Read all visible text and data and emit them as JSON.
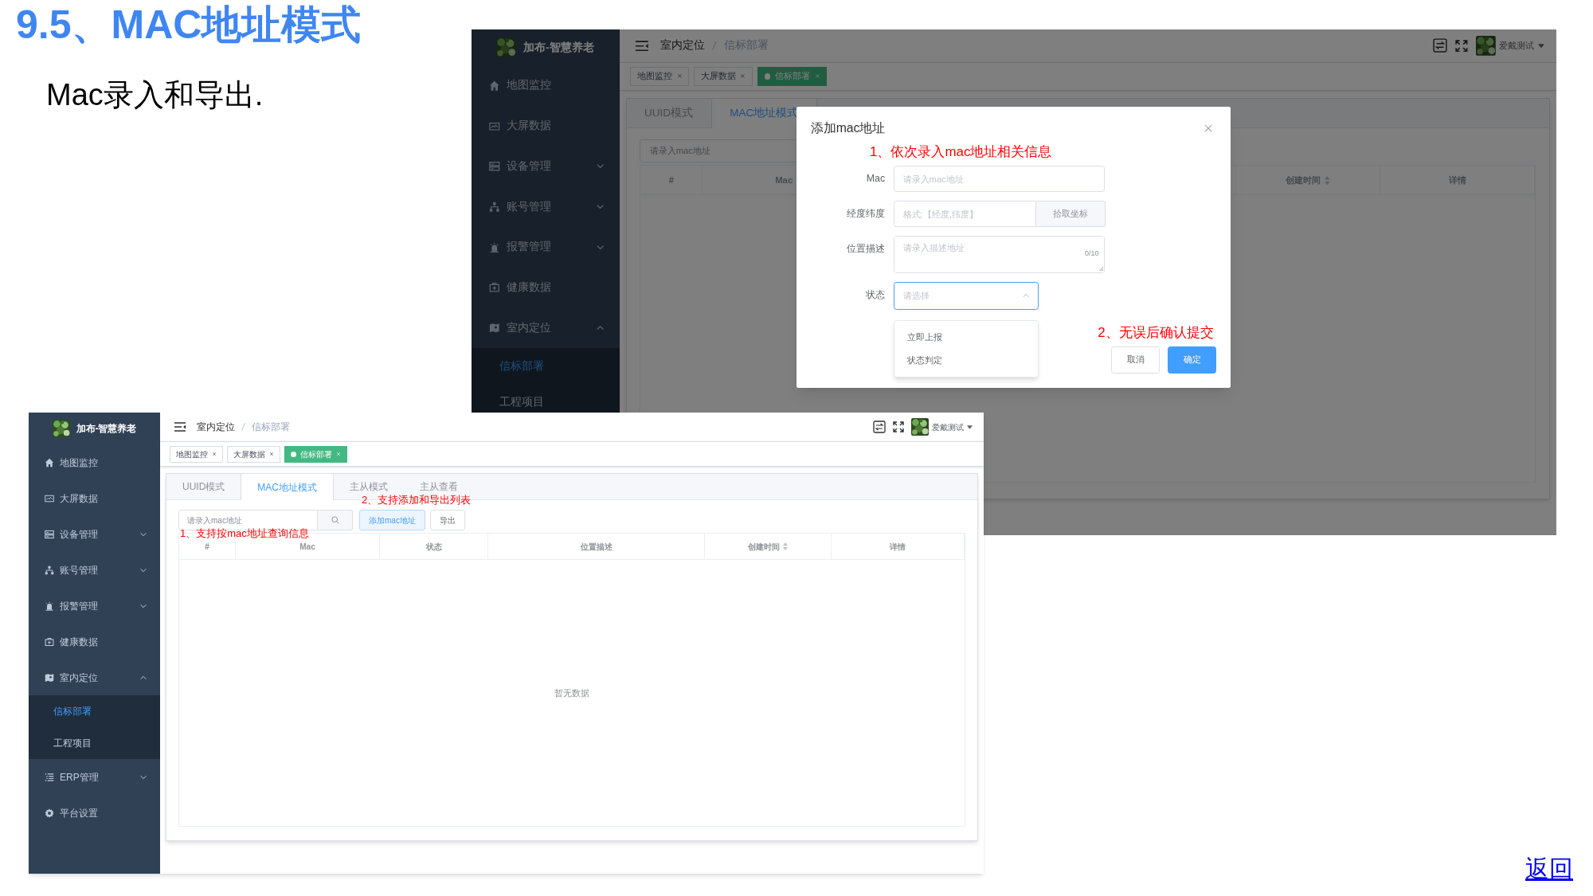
{
  "slide": {
    "title": "9.5、MAC地址模式",
    "subtitle": "Mac录入和导出.",
    "back_link": "返回"
  },
  "screenshots": [
    {
      "app": {
        "sidebar": {
          "logo_text": "加布-智慧养老",
          "items": [
            {
              "label": "地图监控"
            },
            {
              "label": "大屏数据"
            },
            {
              "label": "设备管理",
              "expanded": false
            },
            {
              "label": "账号管理",
              "expanded": false
            },
            {
              "label": "报警管理",
              "expanded": false
            },
            {
              "label": "健康数据"
            },
            {
              "label": "室内定位",
              "expanded": true,
              "children": [
                {
                  "label": "信标部署",
                  "selected": true
                },
                {
                  "label": "工程项目",
                  "selected": false
                }
              ]
            }
          ]
        },
        "header": {
          "breadcrumb": [
            "室内定位",
            "信标部署"
          ],
          "user": "爱戴测试"
        },
        "tags": [
          {
            "label": "地图监控",
            "selected": false
          },
          {
            "label": "大屏数据",
            "selected": false
          },
          {
            "label": "信标部署",
            "selected": true
          }
        ],
        "tabs": [
          {
            "label": "UUID模式",
            "selected": false
          },
          {
            "label": "MAC地址模式",
            "selected": true
          }
        ],
        "search": {
          "placeholder": "请录入mac地址"
        },
        "table": {
          "columns": [
            {
              "label": "#",
              "sortable": false
            },
            {
              "label": "Mac",
              "sortable": false
            },
            {
              "label": "创建时间",
              "sortable": true
            },
            {
              "label": "详情",
              "sortable": false
            }
          ]
        }
      },
      "dialog": {
        "title": "添加mac地址",
        "note": "1、依次录入mac地址相关信息",
        "fields": [
          {
            "kind": "input",
            "label": "Mac",
            "placeholder": "请录入mac地址"
          },
          {
            "kind": "input_button",
            "label": "经度纬度",
            "placeholder": "格式:【经度,纬度】",
            "button": "拾取坐标"
          },
          {
            "kind": "textarea",
            "label": "位置描述",
            "placeholder": "请录入描述地址",
            "counter": "0/10"
          },
          {
            "kind": "select",
            "label": "状态",
            "placeholder": "请选择",
            "expanded": true,
            "options": [
              "立即上报",
              "状态判定"
            ]
          }
        ],
        "note_2": "2、无误后确认提交",
        "buttons": [
          {
            "kind": "default",
            "label": "取消"
          },
          {
            "kind": "primary",
            "label": "确定"
          }
        ]
      }
    },
    {
      "app": {
        "sidebar": {
          "logo_text": "加布-智慧养老",
          "items": [
            {
              "label": "地图监控"
            },
            {
              "label": "大屏数据"
            },
            {
              "label": "设备管理",
              "expanded": false
            },
            {
              "label": "账号管理",
              "expanded": false
            },
            {
              "label": "报警管理",
              "expanded": false
            },
            {
              "label": "健康数据"
            },
            {
              "label": "室内定位",
              "expanded": true,
              "children": [
                {
                  "label": "信标部署",
                  "selected": true
                },
                {
                  "label": "工程项目",
                  "selected": false
                }
              ]
            },
            {
              "label": "ERP管理",
              "expanded": false
            },
            {
              "label": "平台设置"
            }
          ]
        },
        "header": {
          "breadcrumb": [
            "室内定位",
            "信标部署"
          ],
          "user": "爱戴测试"
        },
        "tags": [
          {
            "label": "地图监控",
            "selected": false
          },
          {
            "label": "大屏数据",
            "selected": false
          },
          {
            "label": "信标部署",
            "selected": true
          }
        ],
        "tabs": [
          {
            "label": "UUID模式",
            "selected": false
          },
          {
            "label": "MAC地址模式",
            "selected": true
          },
          {
            "label": "主从模式",
            "selected": false
          },
          {
            "label": "主从查看",
            "selected": false
          }
        ],
        "search": {
          "placeholder": "请录入mac地址"
        },
        "toolbar_buttons": [
          {
            "kind": "primary_plain",
            "label": "添加mac地址"
          },
          {
            "kind": "default",
            "label": "导出"
          }
        ],
        "table": {
          "columns": [
            {
              "label": "#",
              "sortable": false
            },
            {
              "label": "Mac",
              "sortable": false
            },
            {
              "label": "状态",
              "sortable": false
            },
            {
              "label": "位置描述",
              "sortable": false
            },
            {
              "label": "创建时间",
              "sortable": true
            },
            {
              "label": "详情",
              "sortable": false
            }
          ],
          "empty_text": "暂无数据"
        }
      },
      "annotations": [
        "2、支持添加和导出列表",
        "1、支持按mac地址查询信息"
      ]
    }
  ]
}
